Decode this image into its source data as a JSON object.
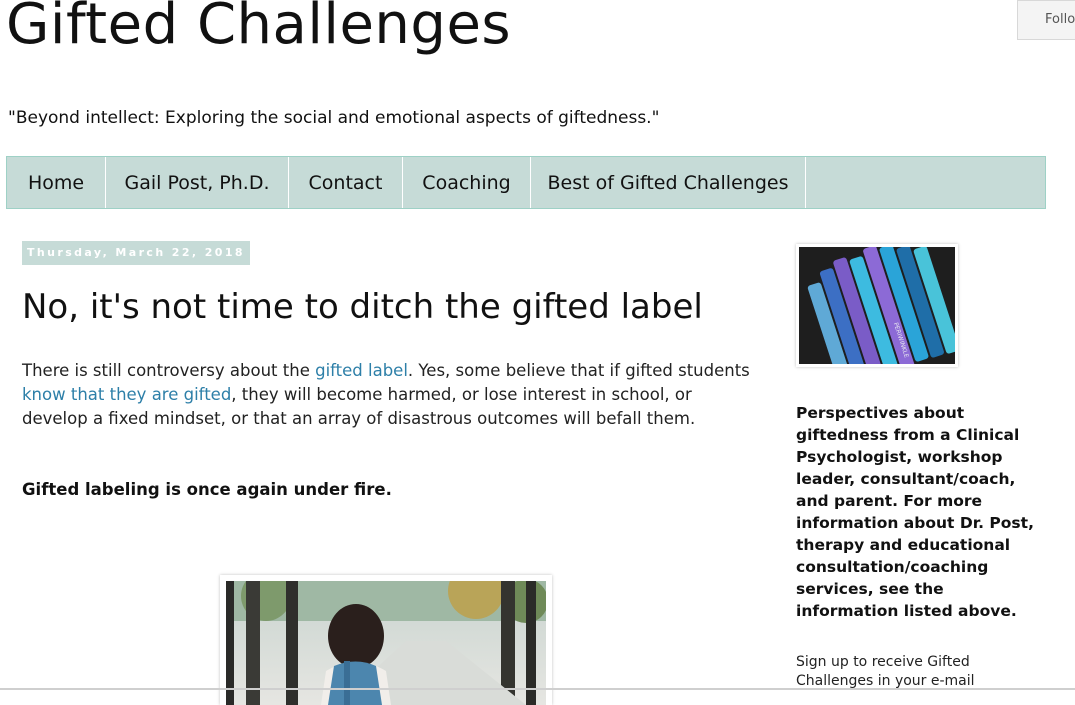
{
  "site": {
    "title": "Gifted Challenges",
    "tagline": "\"Beyond intellect: Exploring the social and emotional aspects of giftedness.\"",
    "follow_label": "Follow"
  },
  "nav": {
    "tabs": [
      {
        "label": "Home"
      },
      {
        "label": "Gail Post, Ph.D."
      },
      {
        "label": "Contact"
      },
      {
        "label": "Coaching"
      },
      {
        "label": "Best of Gifted Challenges"
      }
    ]
  },
  "post": {
    "date": "Thursday, March 22, 2018",
    "title": "No, it's not time to ditch the gifted label",
    "p1_text_a": "There is still controversy about the ",
    "p1_link_a": "gifted label",
    "p1_text_b": ". Yes, some believe that if gifted students ",
    "p1_link_b": "know that they are gifted",
    "p1_text_c": ", they will become harmed, or lose interest in school, or develop a fixed mindset, or that an array of disastrous outcomes will befall them.",
    "subhead": "Gifted labeling is once again under fire."
  },
  "sidebar": {
    "crayon_label": "PERIWINKLE",
    "description": "Perspectives about giftedness from a Clinical Psychologist, workshop leader, consultant/coach, and parent. For more information about Dr. Post, therapy and educational consultation/coaching services, see the information listed above.",
    "signup": "Sign up to receive Gifted Challenges in your e-mail"
  },
  "colors": {
    "nav_bg": "#c6dbd7",
    "link": "#2d7fa8",
    "date_bg": "#c6dbd7"
  }
}
